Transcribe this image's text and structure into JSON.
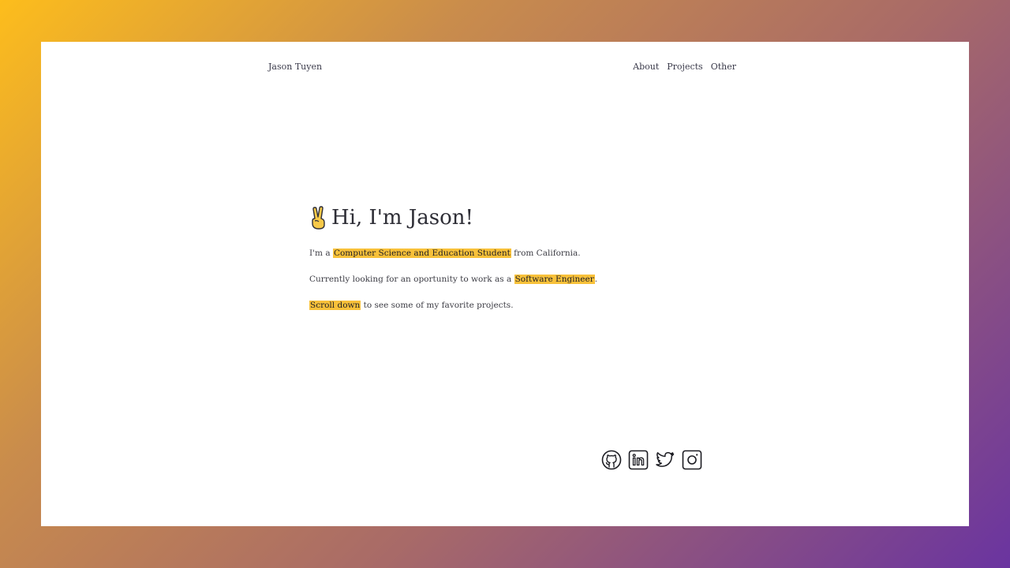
{
  "header": {
    "brand": "Jason Tuyen",
    "nav": [
      "About",
      "Projects",
      "Other"
    ]
  },
  "hero": {
    "emoji_icon": "victory-hand-icon",
    "greeting": "Hi, I'm Jason!",
    "line1": {
      "pre": "I'm a ",
      "highlight": "Computer Science and Education Student",
      "post": " from California."
    },
    "line2": {
      "pre": "Currently looking for an oportunity to work as a ",
      "highlight": "Software Engineer",
      "post": "."
    },
    "line3": {
      "pre": "",
      "highlight": "Scroll down",
      "post": " to see some of my favorite projects."
    }
  },
  "social": [
    "github-icon",
    "linkedin-icon",
    "twitter-icon",
    "instagram-icon"
  ],
  "colors": {
    "highlight": "#f8c13a",
    "gradient_start": "#fdbd1c",
    "gradient_end": "#6a34a0"
  }
}
